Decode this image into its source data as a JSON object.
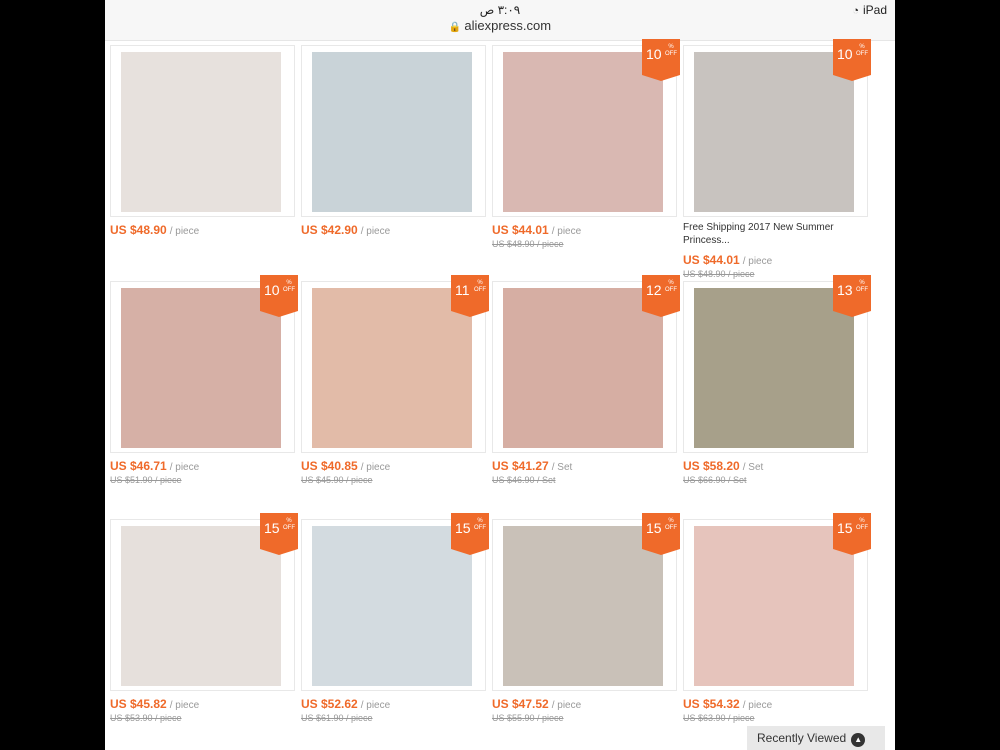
{
  "status": {
    "time": "٣:٠٩ ص",
    "url": "aliexpress.com",
    "device": "iPad"
  },
  "products": [
    {
      "price": "US $48.90",
      "unit": "/ piece",
      "discount": "",
      "old": "",
      "title": "",
      "img": "#e7e1dd"
    },
    {
      "price": "US $42.90",
      "unit": "/ piece",
      "discount": "",
      "old": "",
      "title": "",
      "img": "#c9d3d8"
    },
    {
      "price": "US $44.01",
      "unit": "/ piece",
      "discount": "10",
      "old": "US $48.90 / piece",
      "title": "",
      "img": "#d9b8b2"
    },
    {
      "price": "US $44.01",
      "unit": "/ piece",
      "discount": "10",
      "old": "US $48.90 / piece",
      "title": "Free Shipping 2017 New Summer Princess...",
      "img": "#c8c3bf"
    },
    {
      "price": "US $46.71",
      "unit": "/ piece",
      "discount": "10",
      "old": "US $51.90 / piece",
      "title": "",
      "img": "#d6b0a6"
    },
    {
      "price": "US $40.85",
      "unit": "/ piece",
      "discount": "11",
      "old": "US $45.90 / piece",
      "title": "",
      "img": "#e2bba8"
    },
    {
      "price": "US $41.27",
      "unit": "/ Set",
      "discount": "12",
      "old": "US $46.90 / Set",
      "title": "",
      "img": "#d6aea3"
    },
    {
      "price": "US $58.20",
      "unit": "/ Set",
      "discount": "13",
      "old": "US $66.90 / Set",
      "title": "",
      "img": "#a7a08a"
    },
    {
      "price": "US $45.82",
      "unit": "/ piece",
      "discount": "15",
      "old": "US $53.90 / piece",
      "title": "",
      "img": "#e6e0dc"
    },
    {
      "price": "US $52.62",
      "unit": "/ piece",
      "discount": "15",
      "old": "US $61.90 / piece",
      "title": "",
      "img": "#d3dbe0"
    },
    {
      "price": "US $47.52",
      "unit": "/ piece",
      "discount": "15",
      "old": "US $55.90 / piece",
      "title": "",
      "img": "#c9c1b8"
    },
    {
      "price": "US $54.32",
      "unit": "/ piece",
      "discount": "15",
      "old": "US $63.90 / piece",
      "title": "",
      "img": "#e6c4bc"
    }
  ],
  "badge": {
    "pct": "%",
    "off": "OFF"
  },
  "recently_viewed": "Recently Viewed"
}
